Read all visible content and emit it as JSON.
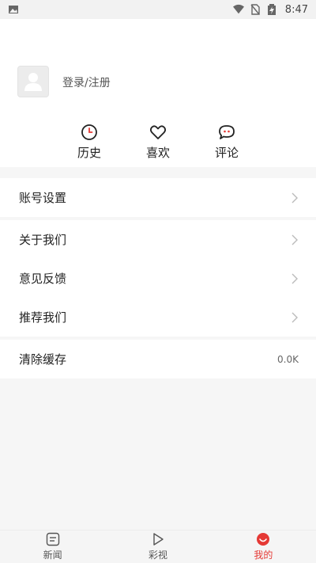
{
  "status_bar": {
    "time": "8:47",
    "icons": [
      "image-notification-icon",
      "wifi-icon",
      "no-sim-icon",
      "battery-charging-icon"
    ]
  },
  "profile": {
    "login_label": "登录/注册",
    "quick_actions": [
      {
        "label": "历史",
        "icon": "clock-icon"
      },
      {
        "label": "喜欢",
        "icon": "heart-icon"
      },
      {
        "label": "评论",
        "icon": "comment-icon"
      }
    ]
  },
  "settings": {
    "account": "账号设置",
    "about": "关于我们",
    "feedback": "意见反馈",
    "recommend": "推荐我们",
    "clear_cache": "清除缓存",
    "cache_size": "0.0K"
  },
  "tabbar": {
    "tabs": [
      {
        "label": "新闻",
        "icon": "news-icon"
      },
      {
        "label": "彩视",
        "icon": "play-icon"
      },
      {
        "label": "我的",
        "icon": "profile-face-icon"
      }
    ],
    "active_index": 2
  },
  "colors": {
    "accent": "#e53935",
    "background": "#f6f6f6",
    "card": "#ffffff"
  }
}
